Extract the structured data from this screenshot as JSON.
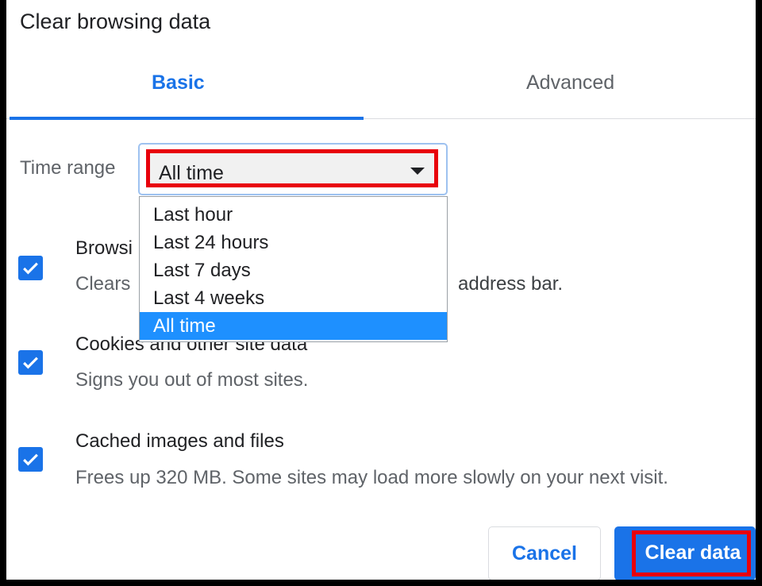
{
  "dialog": {
    "title": "Clear browsing data",
    "tabs": [
      {
        "label": "Basic",
        "active": true
      },
      {
        "label": "Advanced",
        "active": false
      }
    ]
  },
  "time_range": {
    "label": "Time range",
    "selected": "All time",
    "options": [
      "Last hour",
      "Last 24 hours",
      "Last 7 days",
      "Last 4 weeks",
      "All time"
    ]
  },
  "options": [
    {
      "title": "Browsi",
      "desc_left": "Clears",
      "desc_right": "address bar.",
      "checked": true
    },
    {
      "title": "Cookies and other site data",
      "desc": "Signs you out of most sites.",
      "checked": true
    },
    {
      "title": "Cached images and files",
      "desc": "Frees up 320 MB. Some sites may load more slowly on your next visit.",
      "checked": true
    }
  ],
  "buttons": {
    "cancel": "Cancel",
    "clear": "Clear data"
  },
  "colors": {
    "accent": "#1a73e8",
    "highlight_box": "#e8000b",
    "selected_option": "#1e90ff"
  }
}
